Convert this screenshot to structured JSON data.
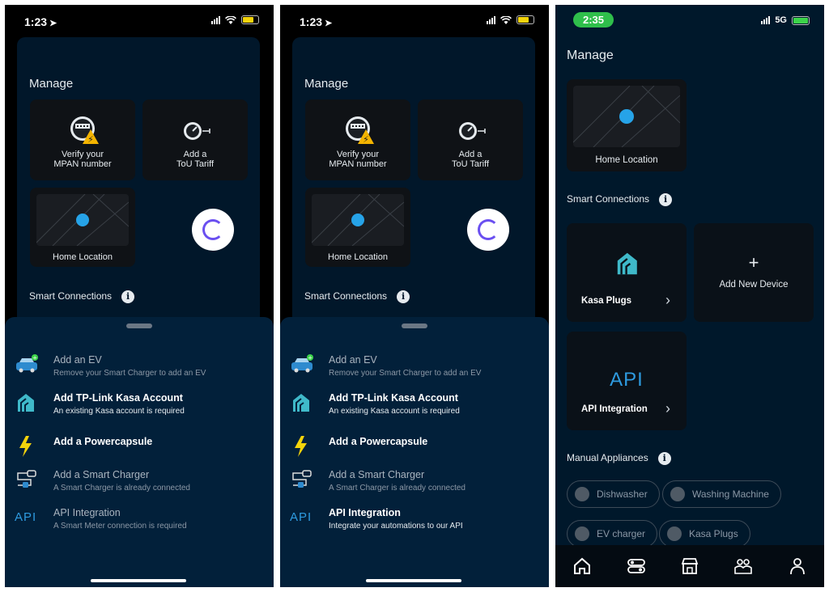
{
  "phone1": {
    "status": {
      "time": "1:23"
    },
    "manage_title": "Manage",
    "tiles": {
      "mpan": "Verify your\nMPAN number",
      "tou": "Add a\nToU Tariff",
      "home": "Home Location"
    },
    "smart_connections": "Smart Connections",
    "options": [
      {
        "title": "Add an EV",
        "subtitle": "Remove your Smart Charger to add an EV"
      },
      {
        "title": "Add TP-Link Kasa Account",
        "subtitle": "An existing Kasa account is required"
      },
      {
        "title": "Add a Powercapsule",
        "subtitle": ""
      },
      {
        "title": "Add a Smart Charger",
        "subtitle": "A Smart Charger is already connected"
      },
      {
        "title": "API Integration",
        "subtitle": "A Smart Meter connection is required"
      }
    ],
    "api_icon_text": "API"
  },
  "phone2": {
    "status": {
      "time": "1:23"
    },
    "manage_title": "Manage",
    "tiles": {
      "mpan": "Verify your\nMPAN number",
      "tou": "Add a\nToU Tariff",
      "home": "Home Location"
    },
    "smart_connections": "Smart Connections",
    "options": [
      {
        "title": "Add an EV",
        "subtitle": "Remove your Smart Charger to add an EV"
      },
      {
        "title": "Add TP-Link Kasa Account",
        "subtitle": "An existing Kasa account is required"
      },
      {
        "title": "Add a Powercapsule",
        "subtitle": ""
      },
      {
        "title": "Add a Smart Charger",
        "subtitle": "A Smart Charger is already connected"
      },
      {
        "title": "API Integration",
        "subtitle": "Integrate your automations to our API"
      }
    ],
    "api_icon_text": "API"
  },
  "phone3": {
    "status": {
      "time": "2:35",
      "network": "5G"
    },
    "manage_title": "Manage",
    "home_location": "Home Location",
    "smart_connections": "Smart Connections",
    "kasa_plugs": "Kasa Plugs",
    "add_new_device": "Add New Device",
    "api_big": "API",
    "api_integration": "API Integration",
    "manual_appliances": "Manual Appliances",
    "chips": [
      "Dishwasher",
      "Washing Machine",
      "EV charger",
      "Kasa Plugs"
    ]
  },
  "colors": {
    "accent_blue": "#26a3e8",
    "kasa_teal": "#3fb9c9",
    "loader_purple": "#6a4ff0",
    "bolt_yellow": "#f4d40b"
  }
}
